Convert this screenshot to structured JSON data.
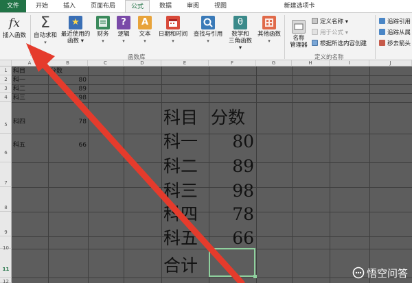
{
  "tabs": [
    {
      "label": "文件"
    },
    {
      "label": "开始"
    },
    {
      "label": "插入"
    },
    {
      "label": "页面布局"
    },
    {
      "label": "公式"
    },
    {
      "label": "数据"
    },
    {
      "label": "审阅"
    },
    {
      "label": "视图"
    },
    {
      "label": "新建选项卡"
    }
  ],
  "ribbon": {
    "insert_function": "插入函数",
    "autosum": "自动求和",
    "recent_line1": "最近使用的",
    "recent_line2": "函数",
    "finance": "财务",
    "logic": "逻辑",
    "text": "文本",
    "datetime": "日期和时间",
    "lookup": "查找与引用",
    "math_line1": "数学和",
    "math_line2": "三角函数",
    "other": "其他函数",
    "group_library": "函数库",
    "name_manager_line1": "名称",
    "name_manager_line2": "管理器",
    "define_name": "定义名称",
    "use_in_formula": "用于公式",
    "create_from_selection": "根据所选内容创建",
    "group_names": "定义的名称",
    "trace_precedents": "追踪引用",
    "trace_dependents": "追踪从属",
    "remove_arrows": "移去箭头"
  },
  "columns": [
    "A",
    "B",
    "C",
    "D",
    "E",
    "F",
    "G",
    "H",
    "I",
    "J"
  ],
  "rows": [
    "1",
    "2",
    "3",
    "4",
    "5",
    "6",
    "7",
    "8",
    "9",
    "10",
    "11",
    "12"
  ],
  "small_table": {
    "header": {
      "subject": "科目",
      "score": "分数"
    },
    "rows": [
      {
        "subject": "科一",
        "score": "80"
      },
      {
        "subject": "科二",
        "score": "89"
      },
      {
        "subject": "科三",
        "score": "98"
      },
      {
        "subject": "科四",
        "score": "78"
      },
      {
        "subject": "科五",
        "score": "66"
      }
    ]
  },
  "big_table": {
    "header": {
      "subject": "科目",
      "score": "分数"
    },
    "rows": [
      {
        "subject": "科一",
        "score": "80"
      },
      {
        "subject": "科二",
        "score": "89"
      },
      {
        "subject": "科三",
        "score": "98"
      },
      {
        "subject": "科四",
        "score": "78"
      },
      {
        "subject": "科五",
        "score": "66"
      }
    ],
    "total_label": "合计"
  },
  "watermark": "悟空问答",
  "colors": {
    "file_tab": "#217346",
    "grid_bg": "#5d5d5d",
    "arrow": "#e53b2c",
    "selection": "#8fd19e"
  }
}
